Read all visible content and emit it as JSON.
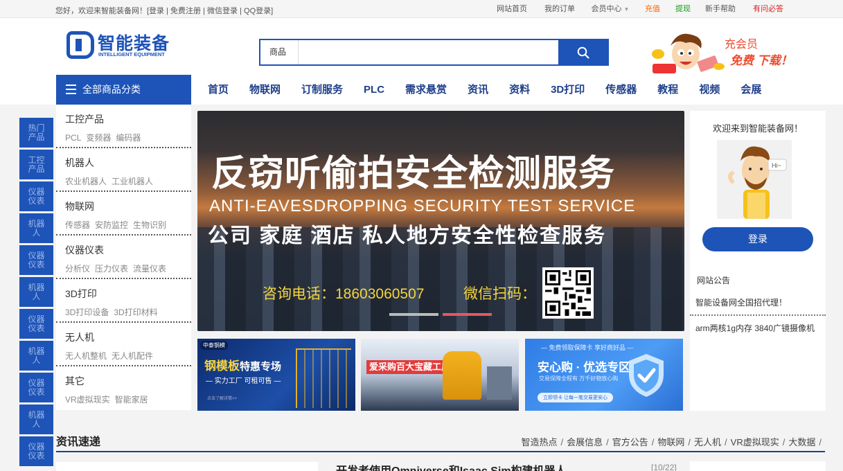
{
  "topbar": {
    "welcome": "您好，欢迎来智能装备网！",
    "auth_links": [
      "[登录",
      "免费注册",
      "微信登录",
      "QQ登录]"
    ],
    "links": [
      {
        "label": "网站首页",
        "color": "normal"
      },
      {
        "label": "我的订单",
        "color": "normal"
      },
      {
        "label": "会员中心",
        "color": "normal",
        "caret": true
      },
      {
        "label": "充值",
        "color": "orange"
      },
      {
        "label": "提现",
        "color": "green"
      },
      {
        "label": "新手帮助",
        "color": "normal"
      },
      {
        "label": "有问必答",
        "color": "red"
      }
    ]
  },
  "logo": {
    "cn": "智能装备",
    "en": "INTELLIGENT EQUIPMENT",
    "color": "#1e54b8"
  },
  "search": {
    "category": "商品",
    "value": "",
    "placeholder": ""
  },
  "promo": {
    "line1": "充会员",
    "line2": "免费 下载！"
  },
  "allcat": {
    "label": "全部商品分类"
  },
  "nav": [
    "首页",
    "物联网",
    "订制服务",
    "PLC",
    "需求悬赏",
    "资讯",
    "资料",
    "3D打印",
    "传感器",
    "教程",
    "视频",
    "会展"
  ],
  "sidetabs": [
    "热门产品",
    "工控产品",
    "仪器仪表",
    "机器人",
    "仪器仪表",
    "机器人",
    "仪器仪表",
    "机器人",
    "仪器仪表",
    "机器人",
    "仪器仪表"
  ],
  "categories": [
    {
      "title": "工控产品",
      "subs": [
        "PCL",
        "变频器",
        "编码器"
      ]
    },
    {
      "title": "机器人",
      "subs": [
        "农业机器人",
        "工业机器人"
      ]
    },
    {
      "title": "物联网",
      "subs": [
        "传感器",
        "安防监控",
        "生物识别"
      ]
    },
    {
      "title": "仪器仪表",
      "subs": [
        "分析仪",
        "压力仪表",
        "流量仪表"
      ]
    },
    {
      "title": "3D打印",
      "subs": [
        "3D打印设备",
        "3D打印材料"
      ]
    },
    {
      "title": "无人机",
      "subs": [
        "无人机整机",
        "无人机配件"
      ]
    },
    {
      "title": "其它",
      "subs": [
        "VR虚拟现实",
        "智能家居"
      ]
    }
  ],
  "banner": {
    "headline": "反窃听偷拍安全检测服务",
    "english": "ANTI-EAVESDROPPING SECURITY TEST SERVICE",
    "subline": "公司 家庭 酒店 私人地方安全性检查服务",
    "phone": "咨询电话：18603060507",
    "wechat": "微信扫码：",
    "slides": 2,
    "active_slide": 2
  },
  "subbanners": {
    "b1": {
      "top": "中泰钢模",
      "main_a": "钢模板",
      "main_b": "特惠专场",
      "tag": "— 实力工厂 可租可售 —",
      "tiny": "点击了解详情>>"
    },
    "b2": {
      "main": "爱采购百大宝藏工厂齐聚惠"
    },
    "b3": {
      "top": "— 免费领取保障卡 享好商好品 —",
      "main": "安心购 · 优选专区",
      "desc": "交易保障全程有 万千好物放心购",
      "pill": "立即领卡 让每一笔交易更安心"
    }
  },
  "rpanel": {
    "welcome": "欢迎来到智能装备网！",
    "hi": "Hi~",
    "login": "登录",
    "notice_title": "网站公告",
    "notice_1": "智能设备网全国招代理！",
    "notice_2": "arm两核1g内存 3840广镜摄像机"
  },
  "news": {
    "title": "资讯速递",
    "tabs": [
      "智造热点",
      "会展信息",
      "官方公告",
      "物联网",
      "无人机",
      "VR虚拟现实",
      "大数据"
    ],
    "headline": "开发者使用Omniverse和Isaac Sim构建机器人",
    "date": "[10/22]"
  }
}
